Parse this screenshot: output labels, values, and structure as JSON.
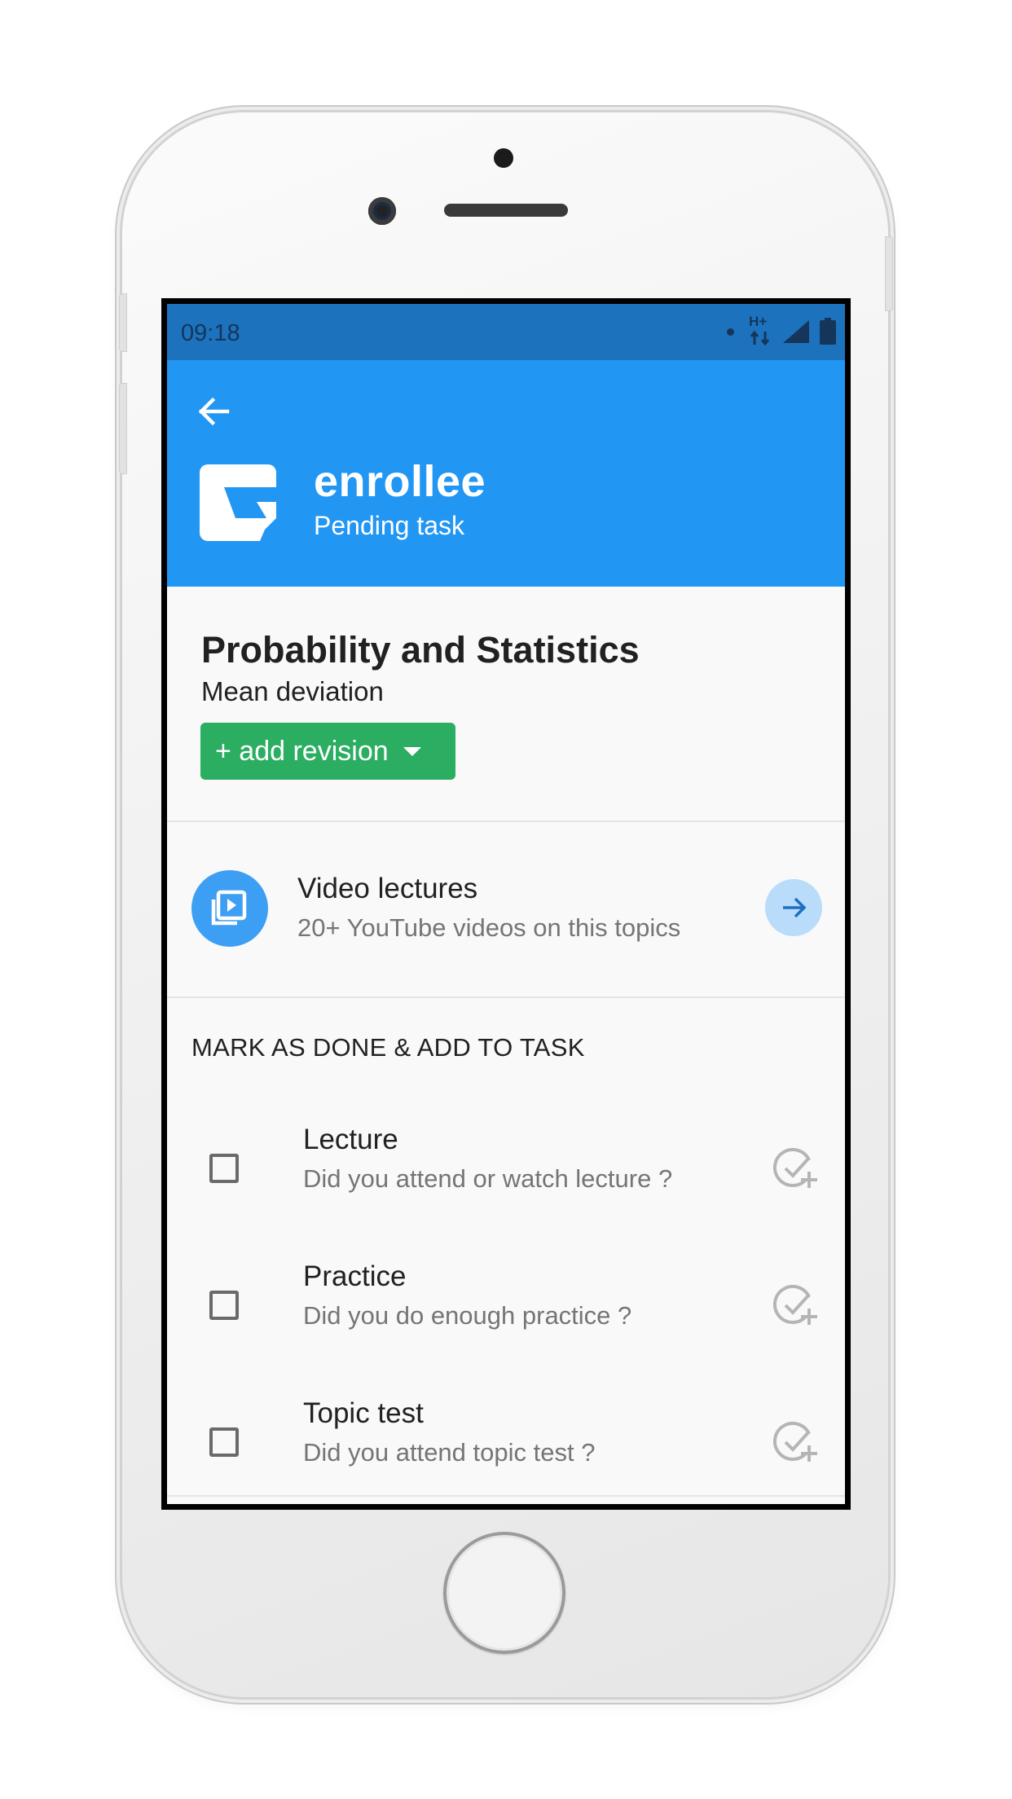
{
  "status_bar": {
    "time": "09:18",
    "network_label": "H+",
    "icons": [
      "notification-dot-icon",
      "data-arrows-icon",
      "signal-icon",
      "battery-icon"
    ]
  },
  "app_bar": {
    "title": "enrollee",
    "subtitle": "Pending task",
    "color": "#2196f3"
  },
  "subject": {
    "title": "Probability and Statistics",
    "topic": "Mean deviation",
    "add_revision_label": "+ add revision",
    "add_revision_color": "#2bae62"
  },
  "video_lectures": {
    "title": "Video lectures",
    "subtitle": "20+ YouTube videos on this topics"
  },
  "tasks_section": {
    "label": "MARK AS DONE & ADD TO TASK",
    "items": [
      {
        "title": "Lecture",
        "subtitle": "Did you attend or watch lecture ?",
        "checked": false
      },
      {
        "title": "Practice",
        "subtitle": "Did you do enough practice ?",
        "checked": false
      },
      {
        "title": "Topic test",
        "subtitle": "Did you attend topic test ?",
        "checked": false
      }
    ]
  }
}
